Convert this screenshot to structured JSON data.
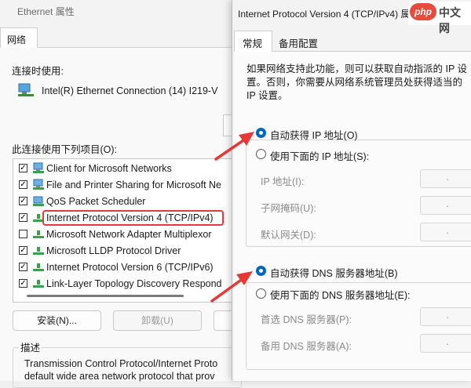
{
  "back_window": {
    "title": "Ethernet 属性",
    "tab": "网络",
    "connect_using_label": "连接时使用:",
    "adapter_name": "Intel(R) Ethernet Connection (14) I219-V",
    "items_label": "此连接使用下列项目(O):",
    "items": [
      {
        "label": "Client for Microsoft Networks",
        "checked": true,
        "icon": "network-client-icon"
      },
      {
        "label": "File and Printer Sharing for Microsoft Ne",
        "checked": true,
        "icon": "sharing-icon"
      },
      {
        "label": "QoS Packet Scheduler",
        "checked": true,
        "icon": "qos-icon"
      },
      {
        "label": "Internet Protocol Version 4 (TCP/IPv4)",
        "checked": true,
        "icon": "protocol-icon",
        "highlighted": true
      },
      {
        "label": "Microsoft Network Adapter Multiplexor",
        "checked": false,
        "icon": "protocol-icon"
      },
      {
        "label": "Microsoft LLDP Protocol Driver",
        "checked": true,
        "icon": "protocol-icon"
      },
      {
        "label": "Internet Protocol Version 6 (TCP/IPv6)",
        "checked": true,
        "icon": "protocol-icon"
      },
      {
        "label": "Link-Layer Topology Discovery Respond",
        "checked": true,
        "icon": "protocol-icon"
      }
    ],
    "install_label": "安装(N)...",
    "uninstall_label": "卸载(U)",
    "description_label": "描述",
    "description_line1": "Transmission Control Protocol/Internet Proto",
    "description_line2": "default wide area network protocol that prov"
  },
  "front_window": {
    "title": "Internet Protocol Version 4 (TCP/IPv4) 属性",
    "tabs": [
      "常规",
      "备用配置"
    ],
    "intro": "如果网络支持此功能，则可以获取自动指派的 IP 设置。否则，你需要从网络系统管理员处获得适当的 IP 设置。",
    "auto_ip_label": "自动获得 IP 地址(O)",
    "manual_ip_label": "使用下面的 IP 地址(S):",
    "ip_address_label": "IP 地址(I):",
    "subnet_label": "子网掩码(U):",
    "gateway_label": "默认网关(D):",
    "auto_dns_label": "自动获得 DNS 服务器地址(B)",
    "manual_dns_label": "使用下面的 DNS 服务器地址(E):",
    "preferred_dns_label": "首选 DNS 服务器(P):",
    "alternate_dns_label": "备用 DNS 服务器(A):",
    "ip_placeholder": ".",
    "auto_ip_selected": true,
    "auto_dns_selected": true
  },
  "watermark": {
    "badge": "php",
    "text": "中文网"
  },
  "colors": {
    "accent": "#0067c0",
    "arrow": "#e53935",
    "highlight": "#e23b3b"
  }
}
